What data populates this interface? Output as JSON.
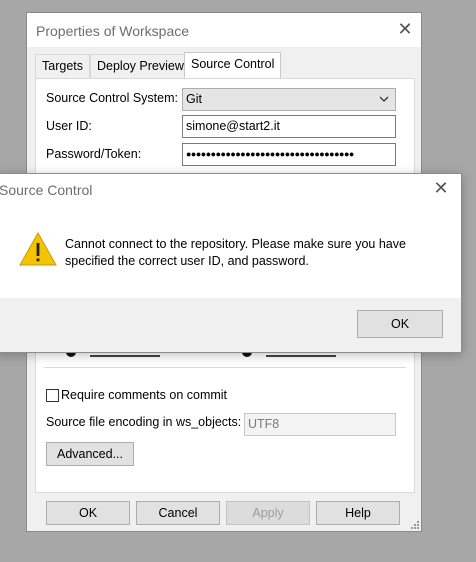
{
  "window": {
    "title": "Properties of Workspace",
    "close_glyph": "✕",
    "tabs": [
      {
        "label": "Targets",
        "active": false
      },
      {
        "label": "Deploy Preview",
        "active": false
      },
      {
        "label": "Source Control",
        "active": true
      }
    ],
    "source_control": {
      "system_label": "Source Control System:",
      "system_value": "Git",
      "user_id_label": "User ID:",
      "user_id_value": "simone@start2.it",
      "password_label": "Password/Token:",
      "password_mask": "●●●●●●●●●●●●●●●●●●●●●●●●●●●●●●●●●●",
      "require_comments_label": "Require comments on commit",
      "encoding_label": "Source file encoding in ws_objects:",
      "encoding_value": "UTF8",
      "advanced_label": "Advanced..."
    },
    "buttons": {
      "ok": "OK",
      "cancel": "Cancel",
      "apply": "Apply",
      "help": "Help"
    }
  },
  "dialog": {
    "title": "Source Control",
    "close_glyph": "✕",
    "icon": "warning-icon",
    "message": "Cannot connect to the repository. Please make sure you have specified the correct user ID, and password.",
    "ok_label": "OK"
  },
  "colors": {
    "backdrop": "#a7a7a7",
    "window_bg": "#f0f0f0",
    "warning_yellow": "#f5c400"
  }
}
